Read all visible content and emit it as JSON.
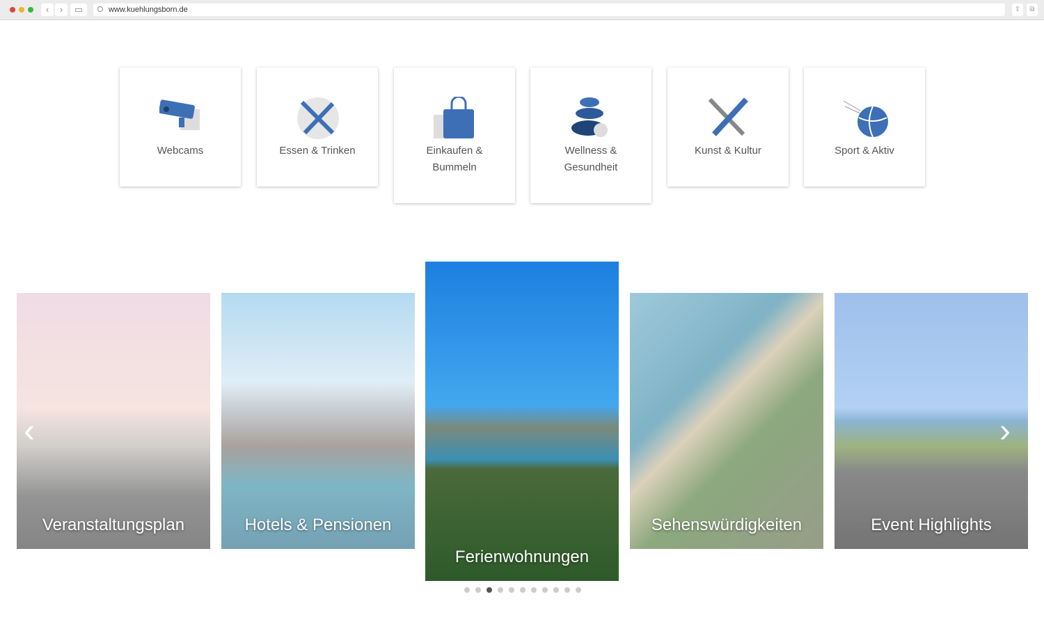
{
  "browser": {
    "url": "www.kuehlungsborn.de"
  },
  "categories": [
    {
      "label": "Webcams",
      "icon": "webcam-icon"
    },
    {
      "label": "Essen & Trinken",
      "icon": "fork-knife-icon"
    },
    {
      "label": "Einkaufen & Bummeln",
      "icon": "shopping-bag-icon"
    },
    {
      "label": "Wellness & Gesundheit",
      "icon": "stones-icon"
    },
    {
      "label": "Kunst & Kultur",
      "icon": "brush-pen-icon"
    },
    {
      "label": "Sport & Aktiv",
      "icon": "ball-icon"
    }
  ],
  "carousel": {
    "slides": [
      {
        "caption": "Veranstaltungsplan"
      },
      {
        "caption": "Hotels & Pensionen"
      },
      {
        "caption": "Ferienwohnungen"
      },
      {
        "caption": "Sehenswürdigkeiten"
      },
      {
        "caption": "Event Highlights"
      }
    ],
    "active_index": 2,
    "dot_count": 11,
    "active_dot": 3
  },
  "colors": {
    "accent": "#3d6fb6"
  }
}
